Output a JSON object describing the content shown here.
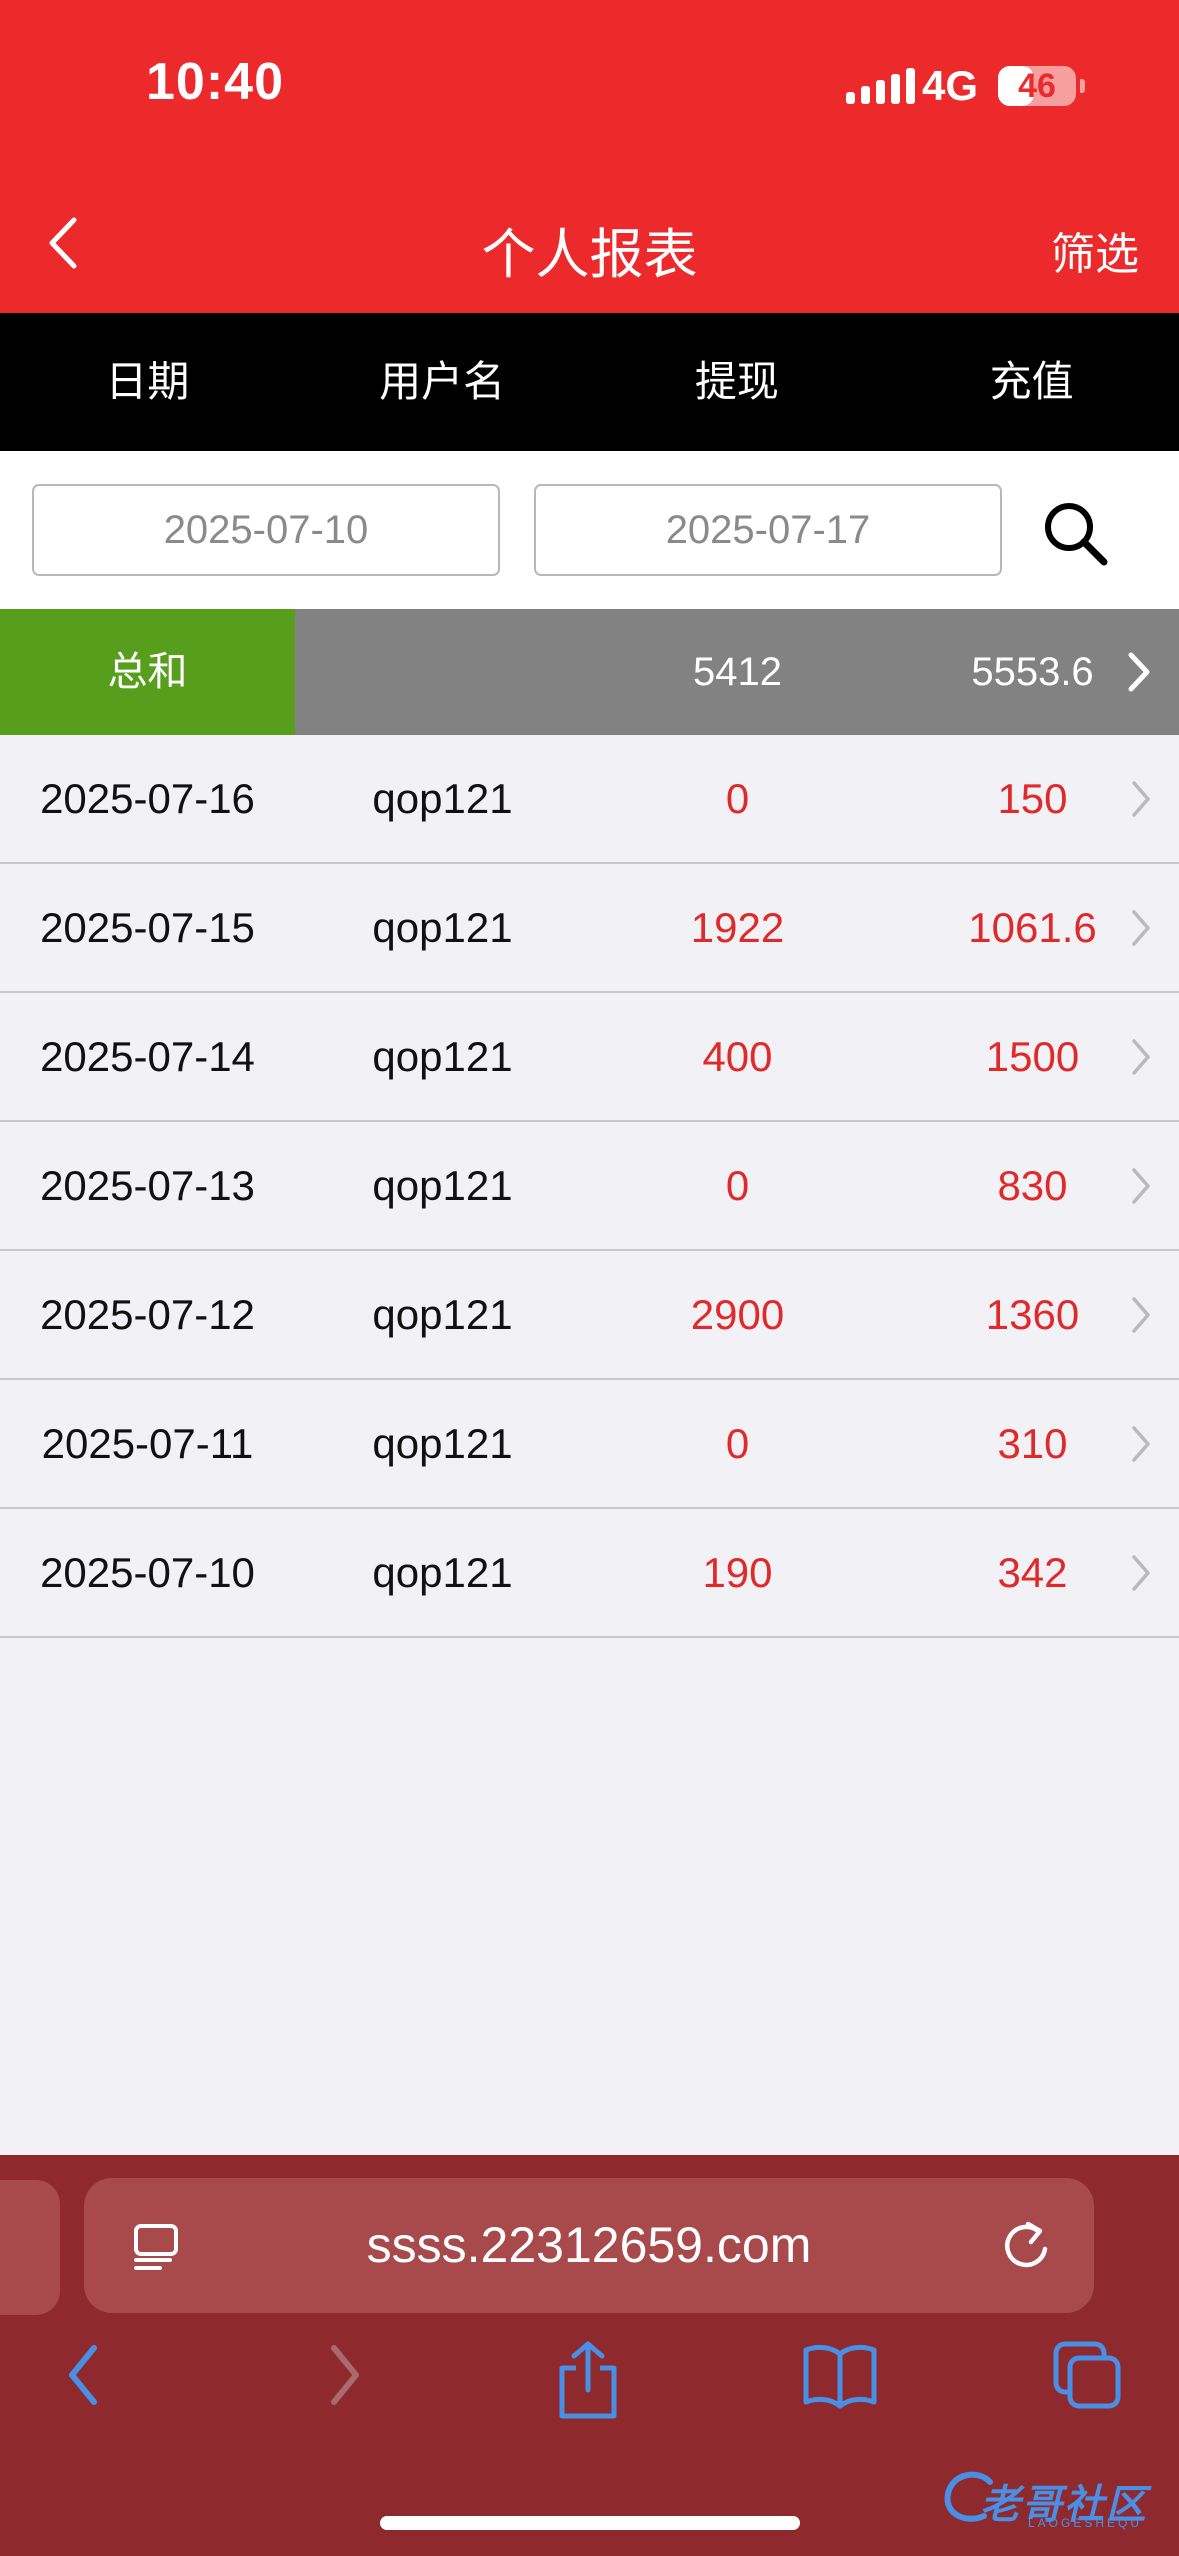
{
  "status_bar": {
    "time": "10:40",
    "network": "4G",
    "battery": "46",
    "battery_level": 0.46
  },
  "header": {
    "title": "个人报表",
    "filter_label": "筛选"
  },
  "columns": [
    "日期",
    "用户名",
    "提现",
    "充值"
  ],
  "search": {
    "start_date": "2025-07-10",
    "end_date": "2025-07-17"
  },
  "total": {
    "label": "总和",
    "withdraw": "5412",
    "recharge": "5553.6"
  },
  "rows": [
    {
      "date": "2025-07-16",
      "user": "qop121",
      "withdraw": "0",
      "recharge": "150"
    },
    {
      "date": "2025-07-15",
      "user": "qop121",
      "withdraw": "1922",
      "recharge": "1061.6"
    },
    {
      "date": "2025-07-14",
      "user": "qop121",
      "withdraw": "400",
      "recharge": "1500"
    },
    {
      "date": "2025-07-13",
      "user": "qop121",
      "withdraw": "0",
      "recharge": "830"
    },
    {
      "date": "2025-07-12",
      "user": "qop121",
      "withdraw": "2900",
      "recharge": "1360"
    },
    {
      "date": "2025-07-11",
      "user": "qop121",
      "withdraw": "0",
      "recharge": "310"
    },
    {
      "date": "2025-07-10",
      "user": "qop121",
      "withdraw": "190",
      "recharge": "342"
    }
  ],
  "browser": {
    "url": "ssss.22312659.com"
  },
  "watermark": {
    "text": "老哥社区",
    "sub": "LAOGESHEQU"
  },
  "colors": {
    "header_red": "#ec2a2c",
    "total_green": "#569e1b",
    "total_gray": "#828282",
    "value_red": "#e02a2a",
    "browser_bar": "#8e2a2d"
  }
}
